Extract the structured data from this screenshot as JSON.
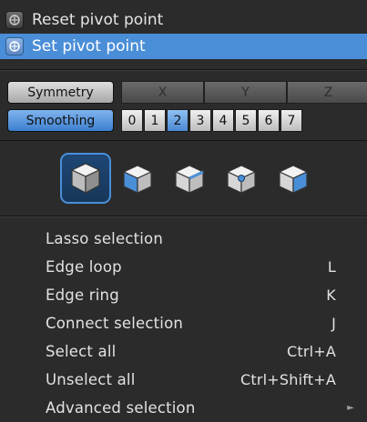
{
  "top_menu": [
    {
      "label": "Reset pivot point",
      "icon": "pivot-reset-icon",
      "selected": false
    },
    {
      "label": "Set pivot point",
      "icon": "pivot-set-icon",
      "selected": true
    }
  ],
  "symmetry": {
    "label": "Symmetry",
    "axes": [
      "X",
      "Y",
      "Z"
    ]
  },
  "smoothing": {
    "label": "Smoothing",
    "levels": [
      "0",
      "1",
      "2",
      "3",
      "4",
      "5",
      "6",
      "7"
    ],
    "active_level": "2"
  },
  "cube_icons": [
    "cube-select-icon",
    "cube-vertex-icon",
    "cube-edge-icon",
    "cube-point-icon",
    "cube-face-icon"
  ],
  "selection_menu": [
    {
      "label": "Lasso selection",
      "shortcut": ""
    },
    {
      "label": "Edge loop",
      "shortcut": "L"
    },
    {
      "label": "Edge ring",
      "shortcut": "K"
    },
    {
      "label": "Connect selection",
      "shortcut": "J"
    },
    {
      "label": "Select all",
      "shortcut": "Ctrl+A"
    },
    {
      "label": "Unselect all",
      "shortcut": "Ctrl+Shift+A"
    },
    {
      "label": "Advanced selection",
      "shortcut": "",
      "submenu": true
    }
  ],
  "colors": {
    "background": "#2b2b2b",
    "highlight": "#4a8ed8",
    "text": "#e4e4e4"
  }
}
